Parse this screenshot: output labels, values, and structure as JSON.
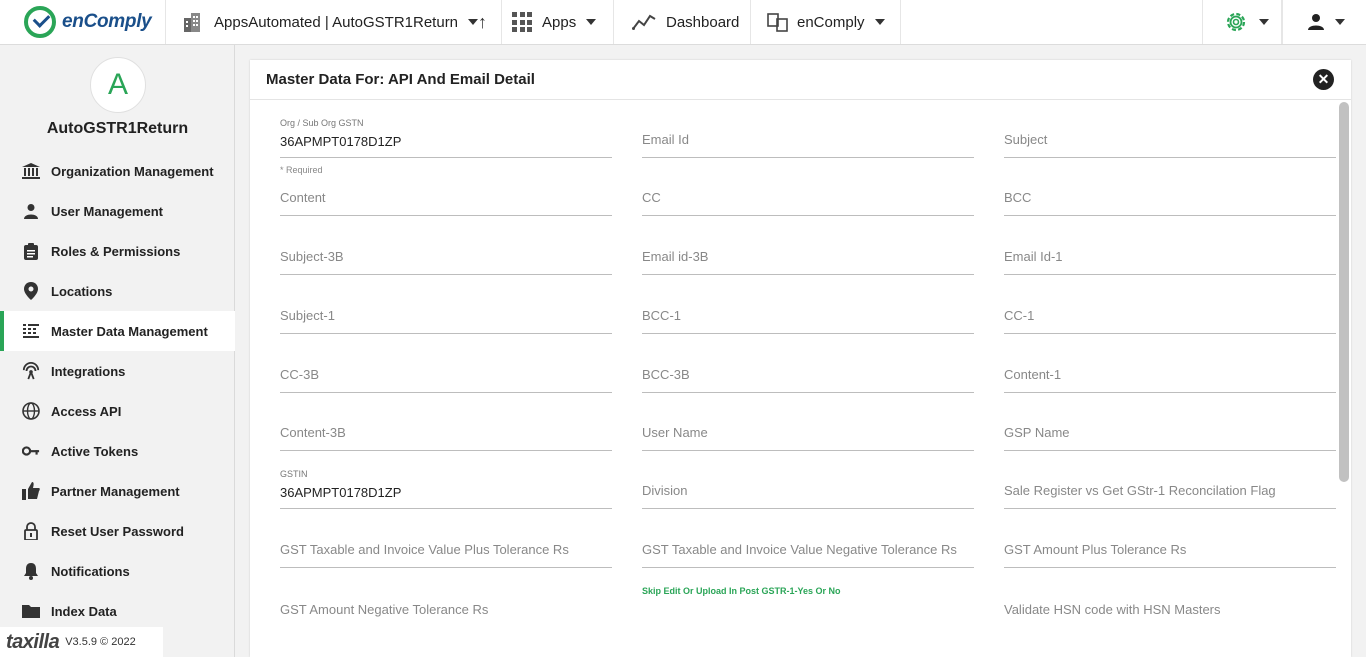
{
  "topbar": {
    "brand": "enComply",
    "org": "AppsAutomated | AutoGSTR1Return",
    "apps": "Apps",
    "dashboard": "Dashboard",
    "product": "enComply"
  },
  "sidebar": {
    "avatar_letter": "A",
    "org_name": "AutoGSTR1Return",
    "items": [
      {
        "label": "Organization Management",
        "icon": "bank-icon"
      },
      {
        "label": "User Management",
        "icon": "person-icon"
      },
      {
        "label": "Roles & Permissions",
        "icon": "clipboard-icon"
      },
      {
        "label": "Locations",
        "icon": "location-pin-icon"
      },
      {
        "label": "Master Data Management",
        "icon": "table-list-icon",
        "active": true
      },
      {
        "label": "Integrations",
        "icon": "antenna-icon"
      },
      {
        "label": "Access API",
        "icon": "globe-icon"
      },
      {
        "label": "Active Tokens",
        "icon": "key-icon"
      },
      {
        "label": "Partner Management",
        "icon": "thumbs-up-icon"
      },
      {
        "label": "Reset User Password",
        "icon": "lock-icon"
      },
      {
        "label": "Notifications",
        "icon": "bell-icon"
      },
      {
        "label": "Index Data",
        "icon": "folder-icon"
      }
    ],
    "footer_brand": "taxilla",
    "version": "V3.5.9 © 2022"
  },
  "panel": {
    "title": "Master Data For: API And Email Detail",
    "close_symbol": "✕",
    "fields": {
      "org_gstn_label": "Org / Sub Org GSTN",
      "org_gstn_value": "36APMPT0178D1ZP",
      "required_note": "* Required",
      "email_id": "Email Id",
      "subject": "Subject",
      "content": "Content",
      "cc": "CC",
      "bcc": "BCC",
      "subject_3b": "Subject-3B",
      "email_id_3b": "Email id-3B",
      "email_id_1": "Email Id-1",
      "subject_1": "Subject-1",
      "bcc_1": "BCC-1",
      "cc_1": "CC-1",
      "cc_3b": "CC-3B",
      "bcc_3b": "BCC-3B",
      "content_1": "Content-1",
      "content_3b": "Content-3B",
      "user_name": "User Name",
      "gsp_name": "GSP Name",
      "gstin_label": "GSTIN",
      "gstin_value": "36APMPT0178D1ZP",
      "division": "Division",
      "sale_register_flag": "Sale Register vs Get GStr-1 Reconcilation Flag",
      "gst_taxable_plus": "GST Taxable and Invoice Value Plus Tolerance Rs",
      "gst_taxable_negative": "GST Taxable and Invoice Value Negative Tolerance Rs",
      "gst_amount_plus": "GST Amount Plus Tolerance Rs",
      "skip_edit_note": "Skip Edit Or Upload In Post GSTR-1-Yes Or No",
      "gst_amount_negative": "GST Amount Negative Tolerance Rs",
      "validate_hsn": "Validate HSN code with HSN Masters"
    }
  }
}
